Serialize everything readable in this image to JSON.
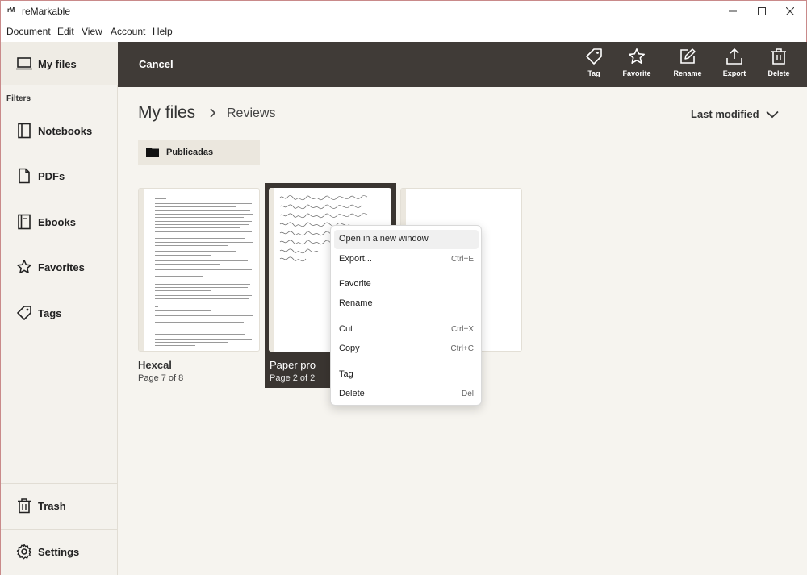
{
  "window": {
    "app_icon": "rM",
    "title": "reMarkable",
    "minimize_icon": "minimize-icon",
    "maximize_icon": "maximize-icon",
    "close_icon": "close-icon"
  },
  "menubar": {
    "items": [
      "Document",
      "Edit",
      "View",
      "Account",
      "Help"
    ]
  },
  "sidebar": {
    "my_files": "My files",
    "filters_label": "Filters",
    "items": [
      {
        "label": "Notebooks",
        "icon": "notebook-icon"
      },
      {
        "label": "PDFs",
        "icon": "pdf-icon"
      },
      {
        "label": "Ebooks",
        "icon": "ebook-icon"
      },
      {
        "label": "Favorites",
        "icon": "star-icon"
      },
      {
        "label": "Tags",
        "icon": "tag-icon"
      }
    ],
    "trash": "Trash",
    "settings": "Settings"
  },
  "toolbar": {
    "cancel": "Cancel",
    "actions": [
      {
        "label": "Tag",
        "icon": "tag-icon"
      },
      {
        "label": "Favorite",
        "icon": "star-icon"
      },
      {
        "label": "Rename",
        "icon": "edit-icon"
      },
      {
        "label": "Export",
        "icon": "export-icon"
      },
      {
        "label": "Delete",
        "icon": "trash-icon"
      }
    ]
  },
  "breadcrumb": {
    "root": "My files",
    "current": "Reviews"
  },
  "sort": {
    "label": "Last modified"
  },
  "folders": [
    {
      "name": "Publicadas",
      "icon": "folder-icon"
    }
  ],
  "documents": [
    {
      "title": "Hexcal",
      "subtitle": "Page 7 of 8",
      "selected": false
    },
    {
      "title": "Paper pro",
      "subtitle": "Page 2 of 2",
      "selected": true
    },
    {
      "title": "",
      "subtitle": "",
      "selected": false
    }
  ],
  "context_menu": {
    "items": [
      {
        "label": "Open in a new window",
        "shortcut": "",
        "hovered": true
      },
      {
        "label": "Export...",
        "shortcut": "Ctrl+E"
      },
      {
        "label": "Favorite",
        "shortcut": ""
      },
      {
        "label": "Rename",
        "shortcut": ""
      },
      {
        "label": "Cut",
        "shortcut": "Ctrl+X"
      },
      {
        "label": "Copy",
        "shortcut": "Ctrl+C"
      },
      {
        "label": "Tag",
        "shortcut": ""
      },
      {
        "label": "Delete",
        "shortcut": "Del"
      }
    ]
  },
  "colors": {
    "toolbar_bg": "#403b37",
    "selected_card_bg": "#3a3531",
    "sidebar_bg": "#f4f2ed",
    "main_bg": "#f6f4ef"
  }
}
